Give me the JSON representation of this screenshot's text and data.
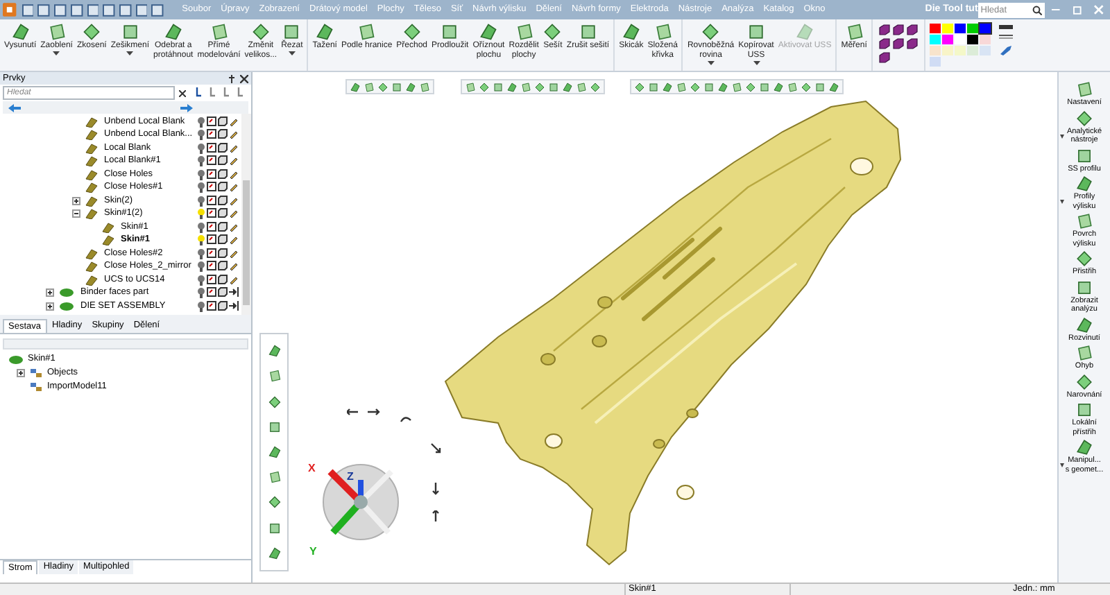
{
  "window": {
    "title": "Die Tool tut",
    "search_placeholder": "Hledat"
  },
  "menu": [
    "Soubor",
    "Úpravy",
    "Zobrazení",
    "Drátový model",
    "Plochy",
    "Těleso",
    "Síť",
    "Návrh výlisku",
    "Dělení",
    "Návrh formy",
    "Elektroda",
    "Nástroje",
    "Analýza",
    "Katalog",
    "Okno"
  ],
  "ribbon": [
    {
      "kind": "group",
      "buttons": [
        {
          "label": "Vysunutí",
          "caret": false,
          "disabled": false
        },
        {
          "label": "Zaoblení",
          "caret": true,
          "disabled": false
        },
        {
          "label": "Zkosení",
          "caret": false,
          "disabled": false
        },
        {
          "label": "Zešikmení",
          "caret": true,
          "disabled": false
        },
        {
          "label": "Odebrat a\nprotáhnout",
          "caret": false,
          "disabled": false
        },
        {
          "label": "Přímé\nmodelování",
          "caret": false,
          "disabled": false
        },
        {
          "label": "Změnit\nvelikos...",
          "caret": false,
          "disabled": false
        },
        {
          "label": "Řezat",
          "caret": true,
          "disabled": false
        }
      ]
    },
    {
      "kind": "group",
      "buttons": [
        {
          "label": "Tažení",
          "caret": false,
          "disabled": false
        },
        {
          "label": "Podle hranice",
          "caret": false,
          "disabled": false
        },
        {
          "label": "Přechod",
          "caret": false,
          "disabled": false
        },
        {
          "label": "Prodloužit",
          "caret": false,
          "disabled": false
        },
        {
          "label": "Oříznout\nplochu",
          "caret": false,
          "disabled": false
        },
        {
          "label": "Rozdělit\nplochy",
          "caret": false,
          "disabled": false
        },
        {
          "label": "Sešít",
          "caret": false,
          "disabled": false
        },
        {
          "label": "Zrušit sešití",
          "caret": false,
          "disabled": false
        }
      ]
    },
    {
      "kind": "group",
      "buttons": [
        {
          "label": "Skicák",
          "caret": false,
          "disabled": false
        },
        {
          "label": "Složená\nkřivka",
          "caret": false,
          "disabled": false
        }
      ]
    },
    {
      "kind": "group",
      "buttons": [
        {
          "label": "Rovnoběžná\nrovina",
          "caret": true,
          "disabled": false
        },
        {
          "label": "Kopírovat\nUSS",
          "caret": true,
          "disabled": false
        },
        {
          "label": "Aktivovat USS",
          "caret": false,
          "disabled": true
        }
      ]
    },
    {
      "kind": "group",
      "buttons": [
        {
          "label": "Měření",
          "caret": false,
          "disabled": false
        }
      ]
    }
  ],
  "palette": [
    {
      "color": "#ff0000",
      "selected": false
    },
    {
      "color": "#ffff00",
      "selected": false
    },
    {
      "color": "#0000ff",
      "selected": false
    },
    {
      "color": "#00cc00",
      "selected": false
    },
    {
      "color": "#0000ff",
      "selected": true
    },
    {
      "color": "#00ffff",
      "selected": false
    },
    {
      "color": "#ff00ff",
      "selected": false
    },
    {
      "color": "#ffffff",
      "selected": false
    },
    {
      "color": "#000000",
      "selected": false
    },
    {
      "color": "#f8d8d8",
      "selected": false
    },
    {
      "color": "#f8e4cc",
      "selected": false
    },
    {
      "color": "#f8f4c8",
      "selected": false
    },
    {
      "color": "#f4f8c8",
      "selected": false
    },
    {
      "color": "#dcecd8",
      "selected": false
    },
    {
      "color": "#d8e4f4",
      "selected": false
    },
    {
      "color": "#d0dcf4",
      "selected": false
    }
  ],
  "features_panel": {
    "title": "Prvky",
    "search_placeholder": "Hledat",
    "tree_continued": [
      {
        "label": "Unbend Local Blank",
        "lit": false,
        "selected": false
      },
      {
        "label": "Unbend Local Blank...",
        "lit": false,
        "selected": false
      },
      {
        "label": "Local Blank",
        "lit": false,
        "selected": false
      },
      {
        "label": "Local Blank#1",
        "lit": false,
        "selected": false
      },
      {
        "label": "Close Holes",
        "lit": false,
        "selected": false
      },
      {
        "label": "Close Holes#1",
        "lit": false,
        "selected": false
      },
      {
        "label": "Skin(2)",
        "lit": false,
        "selected": false,
        "expanded": false
      },
      {
        "label": "Skin#1(2)",
        "lit": true,
        "selected": false,
        "expanded": true,
        "children": [
          {
            "label": "Skin#1",
            "lit": false,
            "selected": false
          },
          {
            "label": "Skin#1",
            "lit": true,
            "selected": true
          }
        ]
      },
      {
        "label": "Close Holes#2",
        "lit": false,
        "selected": false
      },
      {
        "label": "Close Holes_2_mirror",
        "lit": false,
        "selected": false
      },
      {
        "label": "UCS to UCS14",
        "lit": false,
        "selected": false
      }
    ],
    "tree": [
      {
        "label": "Binder faces part",
        "lit": false,
        "selected": false,
        "expanded": false
      },
      {
        "label": "DIE SET ASSEMBLY",
        "lit": false,
        "selected": false,
        "expanded": false
      }
    ],
    "tabs": [
      {
        "label": "Sestava",
        "selected": true
      },
      {
        "label": "Hladiny",
        "selected": false
      },
      {
        "label": "Skupiny",
        "selected": false
      },
      {
        "label": "Dělení",
        "selected": false
      }
    ]
  },
  "object_panel": {
    "tree": [
      {
        "label": "Skin#1",
        "children": [
          {
            "label": "Objects",
            "expanded": false
          },
          {
            "label": "ImportModel11"
          }
        ]
      }
    ],
    "tabs": [
      {
        "label": "Strom",
        "selected": true
      },
      {
        "label": "Hladiny",
        "selected": false
      },
      {
        "label": "Multipohled",
        "selected": false
      }
    ]
  },
  "triad": {
    "x": "X",
    "y": "Y",
    "z": "Z"
  },
  "right_panel": [
    {
      "label": "Nastavení",
      "caret": false
    },
    {
      "label": "Analytické\nnástroje",
      "caret": true
    },
    {
      "label": "SS profilu",
      "caret": false
    },
    {
      "label": "Profily\nvýlisku",
      "caret": true
    },
    {
      "label": "Povrch\nvýlisku",
      "caret": false
    },
    {
      "label": "Přistřih",
      "caret": false
    },
    {
      "label": "Zobrazit\nanalýzu",
      "caret": false
    },
    {
      "label": "Rozvinutí",
      "caret": false
    },
    {
      "label": "Ohyb",
      "caret": false
    },
    {
      "label": "Narovnání",
      "caret": false
    },
    {
      "label": "Lokální\npřístřih",
      "caret": false
    },
    {
      "label": "Manipul...\ns geomet...",
      "caret": true
    }
  ],
  "status_bar": {
    "selection": "Skin#1",
    "units": "Jedn.: mm"
  }
}
